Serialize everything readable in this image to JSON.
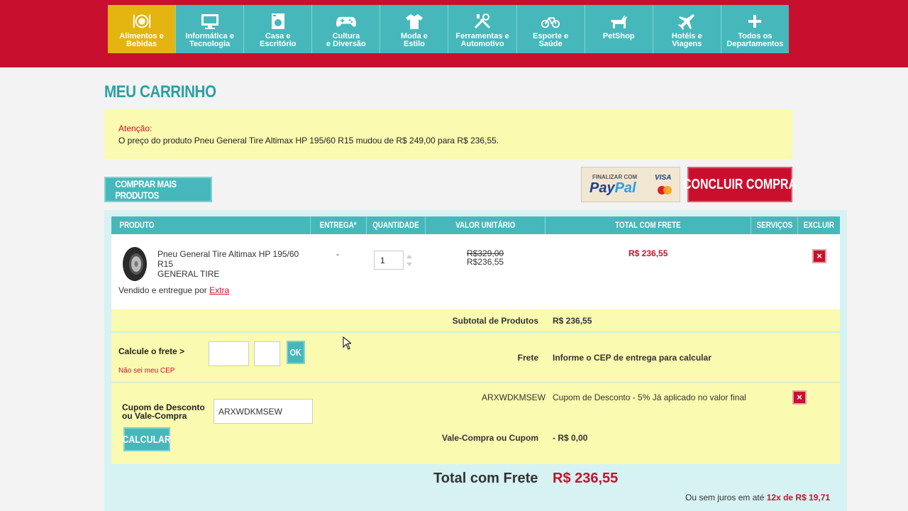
{
  "colors": {
    "brand_red": "#c8102e",
    "teal": "#46b8bb",
    "active_yellow": "#e4b511",
    "alert_bg": "#fafab0"
  },
  "nav": {
    "items": [
      {
        "label": "Alimentos e\nBebidas",
        "icon": "dining-icon",
        "active": true
      },
      {
        "label": "Informática e\nTecnologia",
        "icon": "monitor-icon"
      },
      {
        "label": "Casa e\nEscritório",
        "icon": "washer-icon"
      },
      {
        "label": "Cultura\ne Diversão",
        "icon": "gamepad-icon"
      },
      {
        "label": "Moda e\nEstilo",
        "icon": "tshirt-icon"
      },
      {
        "label": "Ferramentas e\nAutomotivo",
        "icon": "tools-icon"
      },
      {
        "label": "Esporte e\nSaúde",
        "icon": "bicycle-icon"
      },
      {
        "label": "PetShop",
        "icon": "dog-icon"
      },
      {
        "label": "Hotéis e\nViagens",
        "icon": "airplane-icon"
      },
      {
        "label": "Todos os\nDepartamentos",
        "icon": "plus-icon"
      }
    ]
  },
  "page": {
    "title": "MEU CARRINHO"
  },
  "alert": {
    "heading": "Atenção:",
    "message": "O preço do produto Pneu General Tire Altimax HP 195/60 R15 mudou de R$ 249,00 para R$ 236,55."
  },
  "actions": {
    "more_products": "COMPRAR MAIS PRODUTOS",
    "paypal_small": "FINALIZAR COM",
    "paypal_brand_a": "Pay",
    "paypal_brand_b": "Pal",
    "paypal_visa": "VISA",
    "checkout": "CONCLUIR COMPRA"
  },
  "table": {
    "headers": [
      "PRODUTO",
      "ENTREGA*",
      "QUANTIDADE",
      "VALOR UNITÁRIO",
      "TOTAL COM FRETE",
      "SERVIÇOS",
      "EXCLUIR"
    ]
  },
  "item": {
    "name": "Pneu General Tire Altimax HP 195/60 R15",
    "brand": "GENERAL TIRE",
    "seller_prefix": "Vendido e entregue por ",
    "seller": "Extra",
    "delivery": "-",
    "quantity": "1",
    "old_price": "R$329,00",
    "unit_price": "R$236,55",
    "total": "R$ 236,55"
  },
  "summary": {
    "subtotal_label": "Subtotal de Produtos",
    "subtotal_value": "R$ 236,55",
    "shipping_calc_label": "Calcule o frete >",
    "cep_link": "Não sei meu CEP",
    "ok_label": "OK",
    "shipping_label": "Frete",
    "shipping_value": "Informe o CEP de entrega para calcular",
    "coupon_code": "ARXWDKMSEW",
    "coupon_desc": "Cupom de Desconto - 5% Já aplicado no valor final",
    "coupon_label": "Cupom de Desconto\nou Vale-Compra",
    "coupon_input": "ARXWDKMSEW",
    "calc_label": "CALCULAR",
    "voucher_label": "Vale-Compra ou Cupom",
    "voucher_value": "- R$ 0,00",
    "total_label": "Total com Frete",
    "total_value": "R$ 236,55",
    "installments_prefix": "Ou sem juros em até ",
    "installments_value": "12x de R$ 19,71"
  }
}
